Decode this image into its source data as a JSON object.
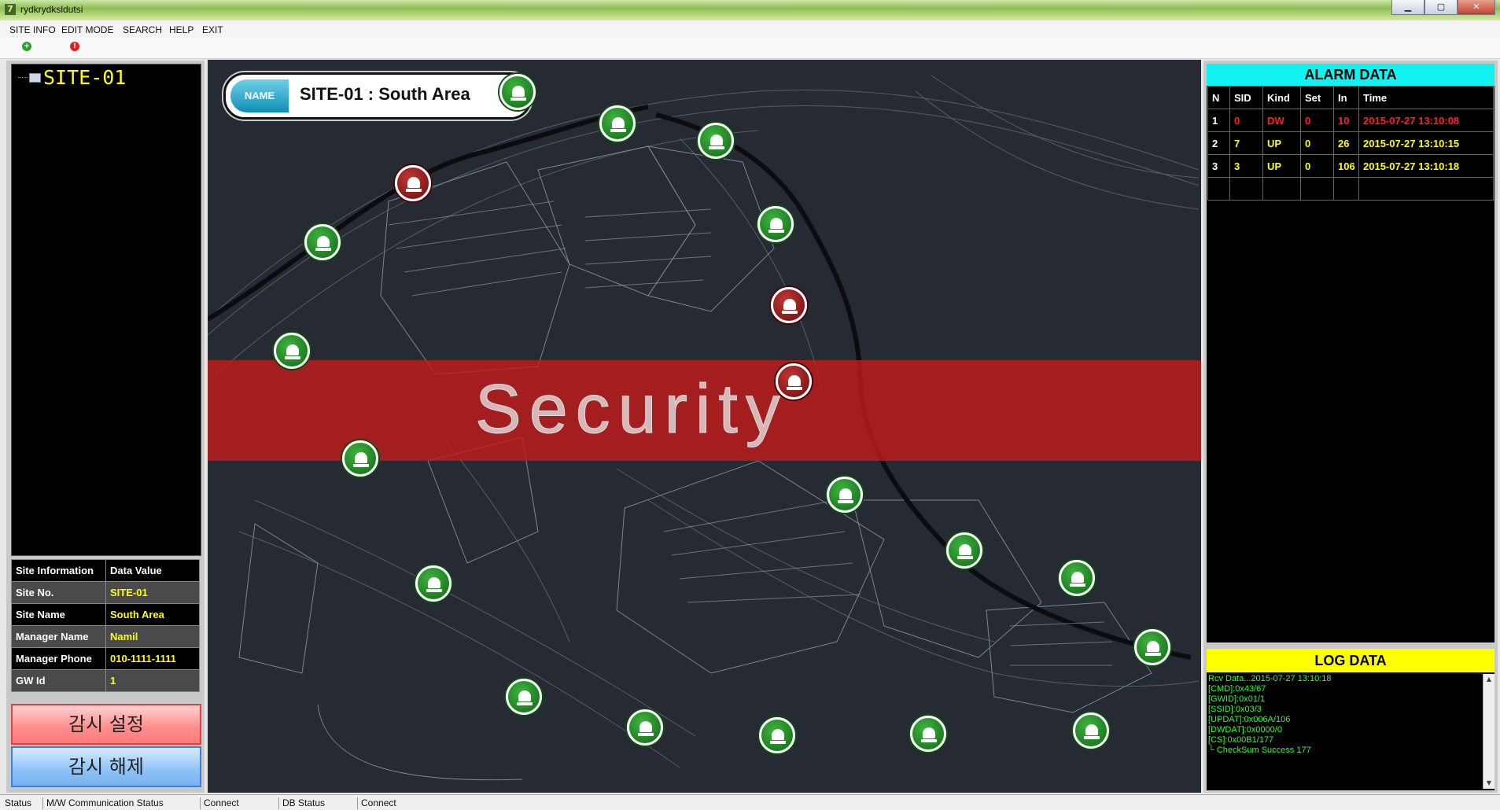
{
  "window": {
    "title": "rydkrydksldutsi"
  },
  "menu": [
    "SITE INFO",
    "EDIT MODE",
    "SEARCH",
    "HELP",
    "EXIT"
  ],
  "tree": {
    "root_label": "SITE-01"
  },
  "site_info": {
    "header": [
      "Site Information",
      "Data Value"
    ],
    "rows": [
      {
        "key": "Site No.",
        "value": "SITE-01"
      },
      {
        "key": "Site Name",
        "value": "South Area"
      },
      {
        "key": "Manager Name",
        "value": "Namil"
      },
      {
        "key": "Manager Phone",
        "value": "010-1111-1111"
      },
      {
        "key": "GW Id",
        "value": "1"
      }
    ]
  },
  "buttons": {
    "monitor_set": "감시 설정",
    "monitor_clear": "감시 해제"
  },
  "map": {
    "name_tag": "NAME",
    "name_text": "SITE-01 : South Area",
    "overlay_text": "Security",
    "colors": {
      "normal": "#1b8a1f",
      "alarm": "#8a1212",
      "band": "#c41c1c"
    },
    "markers": [
      {
        "status": "green"
      },
      {
        "status": "green"
      },
      {
        "status": "green"
      },
      {
        "status": "red"
      },
      {
        "status": "green"
      },
      {
        "status": "green"
      },
      {
        "status": "red"
      },
      {
        "status": "red"
      },
      {
        "status": "green"
      },
      {
        "status": "green"
      },
      {
        "status": "green"
      },
      {
        "status": "green"
      },
      {
        "status": "green"
      },
      {
        "status": "green"
      },
      {
        "status": "green"
      },
      {
        "status": "green"
      },
      {
        "status": "green"
      },
      {
        "status": "green"
      },
      {
        "status": "green"
      },
      {
        "status": "green"
      }
    ]
  },
  "alarm": {
    "title": "ALARM DATA",
    "columns": [
      "N",
      "SID",
      "Kind",
      "Set",
      "In",
      "Time"
    ],
    "rows": [
      [
        "1",
        "0",
        "DW",
        "0",
        "10",
        "2015-07-27 13:10:08"
      ],
      [
        "2",
        "7",
        "UP",
        "0",
        "26",
        "2015-07-27 13:10:15"
      ],
      [
        "3",
        "3",
        "UP",
        "0",
        "106",
        "2015-07-27 13:10:18"
      ]
    ]
  },
  "log": {
    "title": "LOG DATA",
    "lines": [
      "Rcv Data...2015-07-27 13:10:18",
      "[CMD]:0x43/67",
      "[GWID]:0x01/1",
      "[SSID]:0x03/3",
      "[UPDAT]:0x006A/106",
      "[DWDAT]:0x0000/0",
      "[CS]:0x00B1/177",
      "└ CheckSum Success 177"
    ]
  },
  "status": [
    "Status",
    "M/W Communication Status",
    "Connect",
    "DB Status",
    "Connect"
  ]
}
